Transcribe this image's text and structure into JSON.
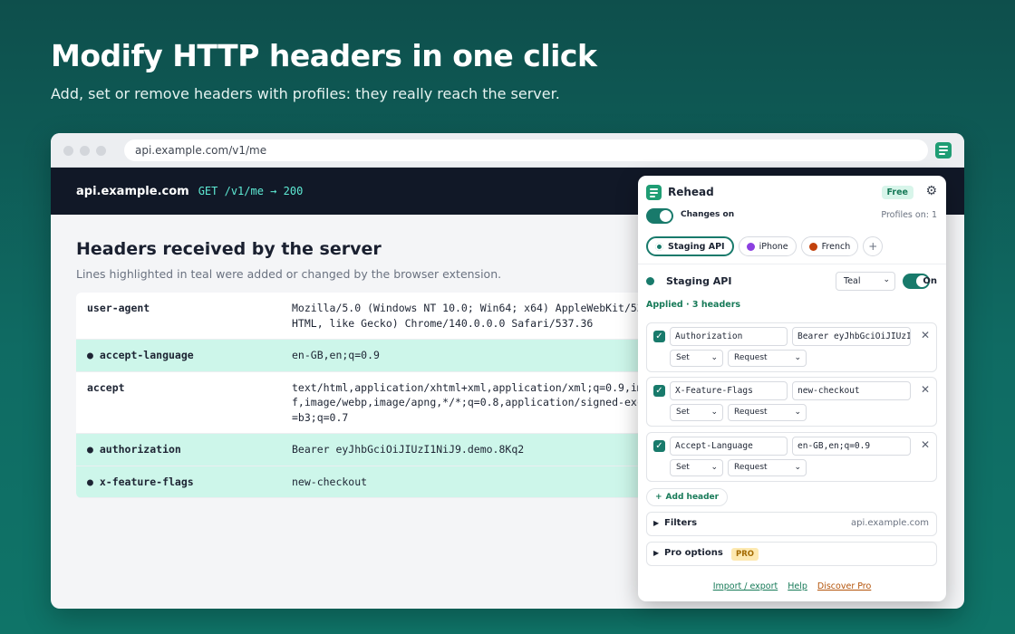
{
  "hero": {
    "title": "Modify HTTP headers in one click",
    "subtitle": "Add, set or remove headers with profiles: they really reach the server."
  },
  "browser": {
    "url": "api.example.com/v1/me",
    "extension_icon": "rehead-logo-icon"
  },
  "site": {
    "host": "api.example.com",
    "request": "GET /v1/me → 200",
    "page_title": "Headers received by the server",
    "note": "Lines highlighted in teal were added or changed by the browser extension.",
    "rows": [
      {
        "name": "user-agent",
        "value": "Mozilla/5.0 (Windows NT 10.0; Win64; x64) AppleWebKit/537.3\nHTML, like Gecko) Chrome/140.0.0.0 Safari/537.36",
        "highlighted": false
      },
      {
        "name": "● accept-language",
        "value": "en-GB,en;q=0.9",
        "highlighted": true
      },
      {
        "name": "accept",
        "value": "text/html,application/xhtml+xml,application/xml;q=0.9,image\nf,image/webp,image/apng,*/*;q=0.8,application/signed-exchar\n=b3;q=0.7",
        "highlighted": false
      },
      {
        "name": "● authorization",
        "value": "Bearer eyJhbGciOiJIUzI1NiJ9.demo.8Kq2",
        "highlighted": true
      },
      {
        "name": "● x-feature-flags",
        "value": "new-checkout",
        "highlighted": true
      }
    ]
  },
  "popup": {
    "title": "Rehead",
    "plan_badge": "Free",
    "changes_label": "Changes on",
    "profiles_on": "Profiles on: 1",
    "tabs": [
      {
        "label": "Staging API",
        "color": "#187a6b",
        "active": true
      },
      {
        "label": "iPhone",
        "color": "#8b3fe0",
        "active": false
      },
      {
        "label": "French",
        "color": "#c2410c",
        "active": false
      }
    ],
    "add_tab": "+",
    "profile": {
      "name": "Staging API",
      "color_option": "Teal",
      "on_label": "On",
      "applied": "Applied · 3 headers"
    },
    "headers": [
      {
        "name": "Authorization",
        "value": "Bearer eyJhbGciOiJIUzI",
        "operation": "Set",
        "target": "Request",
        "enabled": true
      },
      {
        "name": "X-Feature-Flags",
        "value": "new-checkout",
        "operation": "Set",
        "target": "Request",
        "enabled": true
      },
      {
        "name": "Accept-Language",
        "value": "en-GB,en;q=0.9",
        "operation": "Set",
        "target": "Request",
        "enabled": true
      }
    ],
    "add_header": "Add header",
    "filters_label": "Filters",
    "filters_value": "api.example.com",
    "pro_label": "Pro options",
    "pro_badge": "PRO",
    "footer": {
      "import_export": "Import / export",
      "help": "Help",
      "discover_pro": "Discover Pro"
    }
  }
}
